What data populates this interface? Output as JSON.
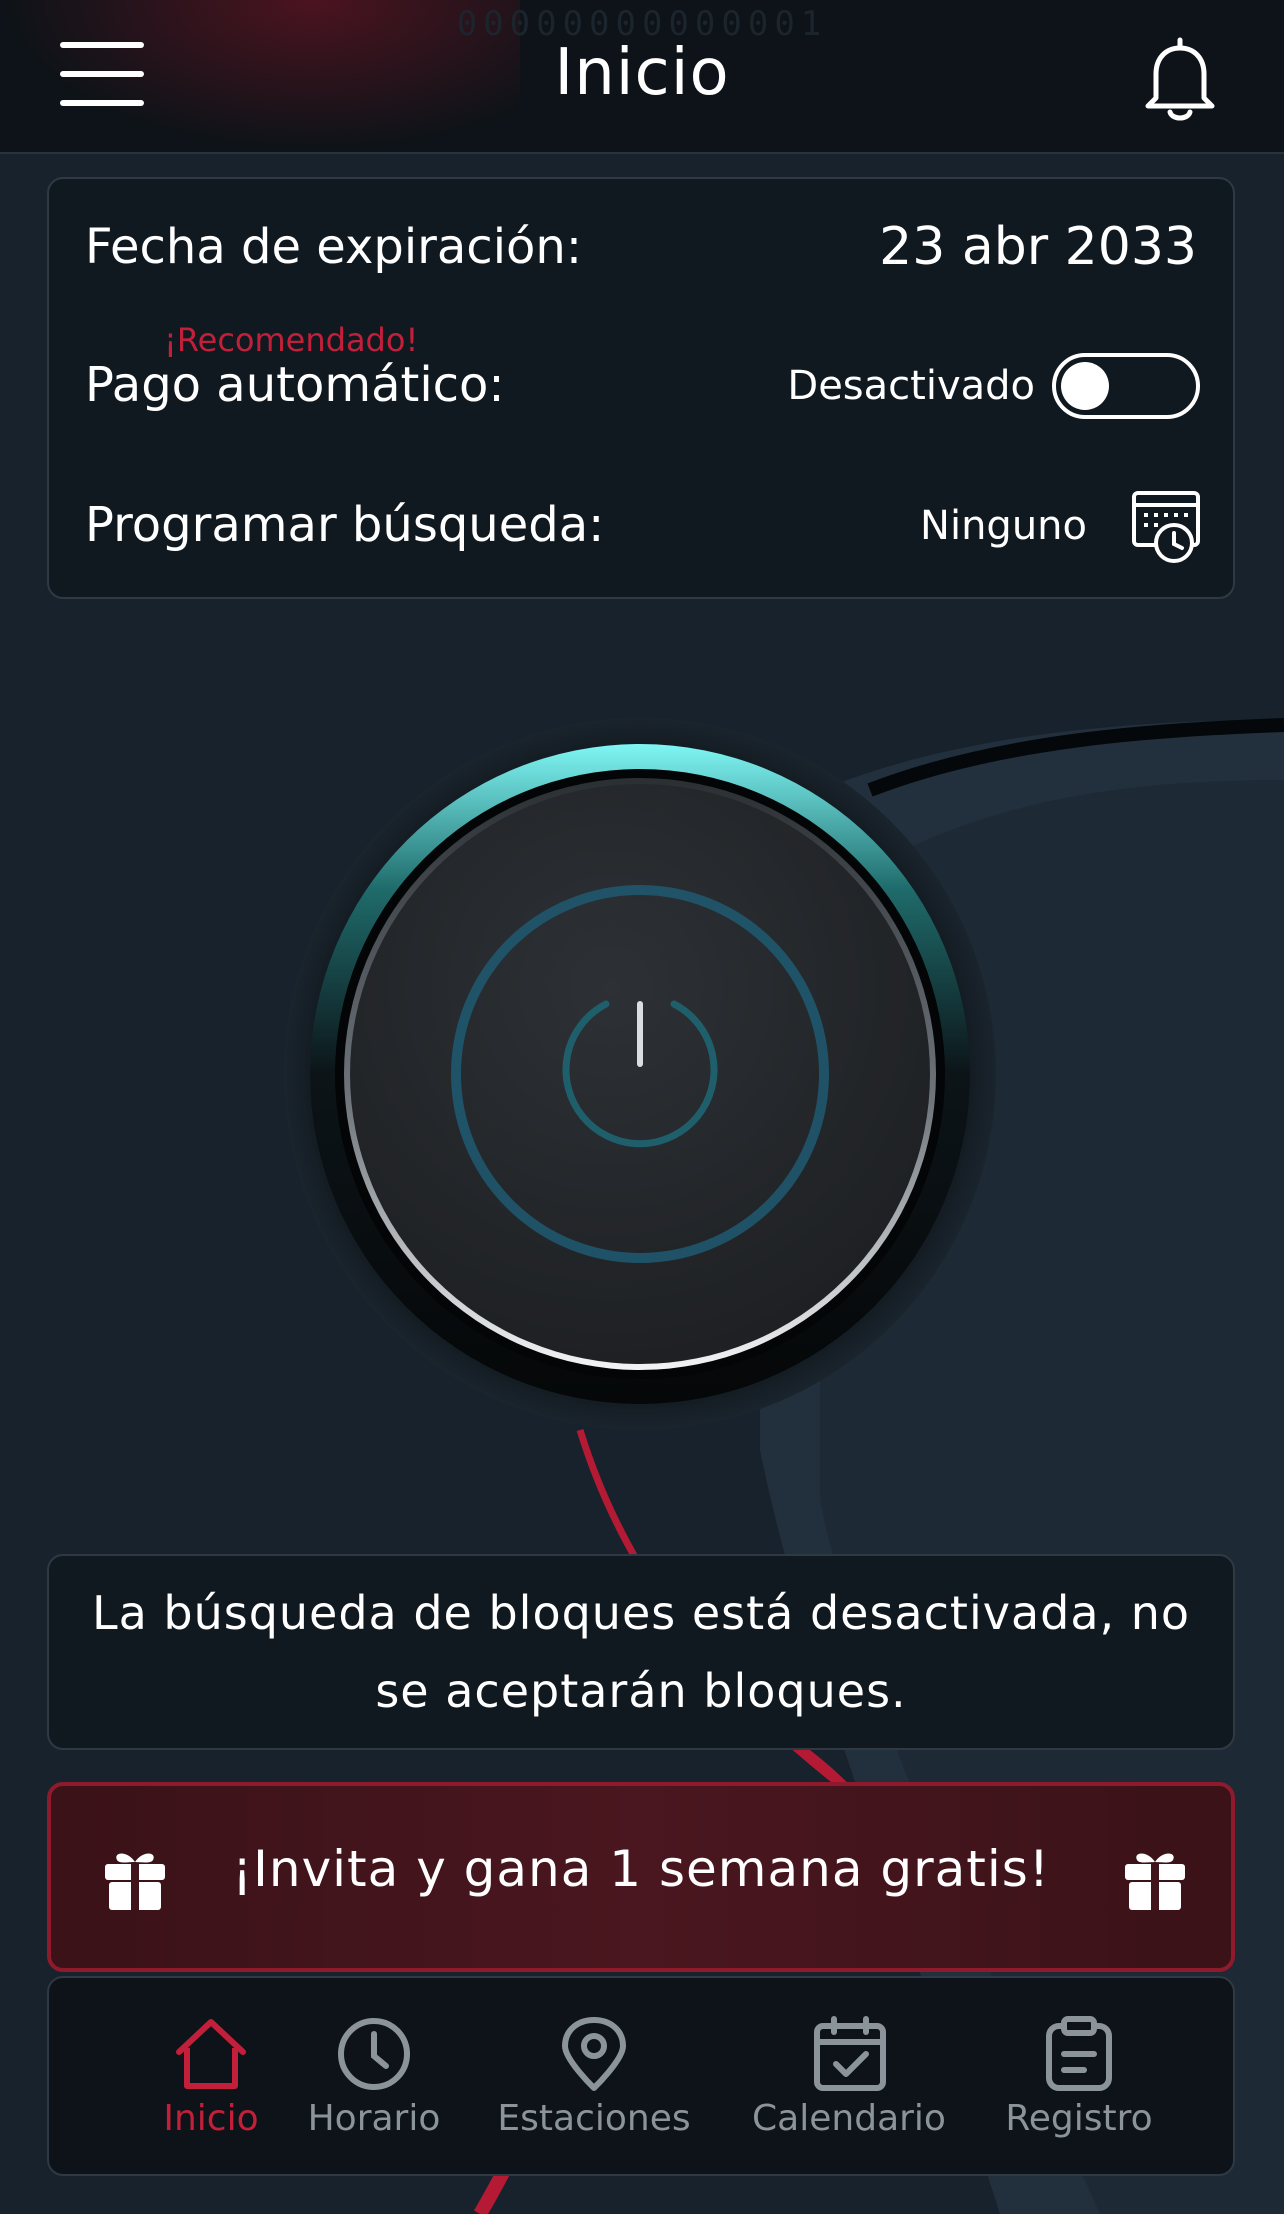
{
  "header": {
    "device_id": "00000000000001",
    "title": "Inicio",
    "menu_icon": "hamburger-menu-icon",
    "notification_icon": "bell-icon"
  },
  "account": {
    "expiration_label": "Fecha de expiración:",
    "expiration_value": "23 abr 2033",
    "autopay_badge": "¡Recomendado!",
    "autopay_label": "Pago automático:",
    "autopay_status": "Desactivado",
    "autopay_enabled": false,
    "schedule_label": "Programar búsqueda:",
    "schedule_value": "Ninguno",
    "schedule_icon": "calendar-clock-icon"
  },
  "power": {
    "icon": "power-icon",
    "active": false
  },
  "status": {
    "message": "La búsqueda de bloques está desactivada, no se aceptarán bloques."
  },
  "invite": {
    "text": "¡Invita y gana 1 semana gratis!",
    "icon": "gift-icon"
  },
  "nav": {
    "items": [
      {
        "label": "Inicio",
        "icon": "home-icon",
        "active": true
      },
      {
        "label": "Horario",
        "icon": "clock-icon",
        "active": false
      },
      {
        "label": "Estaciones",
        "icon": "location-pin-icon",
        "active": false
      },
      {
        "label": "Calendario",
        "icon": "calendar-check-icon",
        "active": false
      },
      {
        "label": "Registro",
        "icon": "clipboard-icon",
        "active": false
      }
    ]
  },
  "colors": {
    "background": "#17222d",
    "accent_red": "#c21f3a",
    "ring_cyan": "#6ff3f0",
    "inactive_gray": "#8c949b"
  }
}
